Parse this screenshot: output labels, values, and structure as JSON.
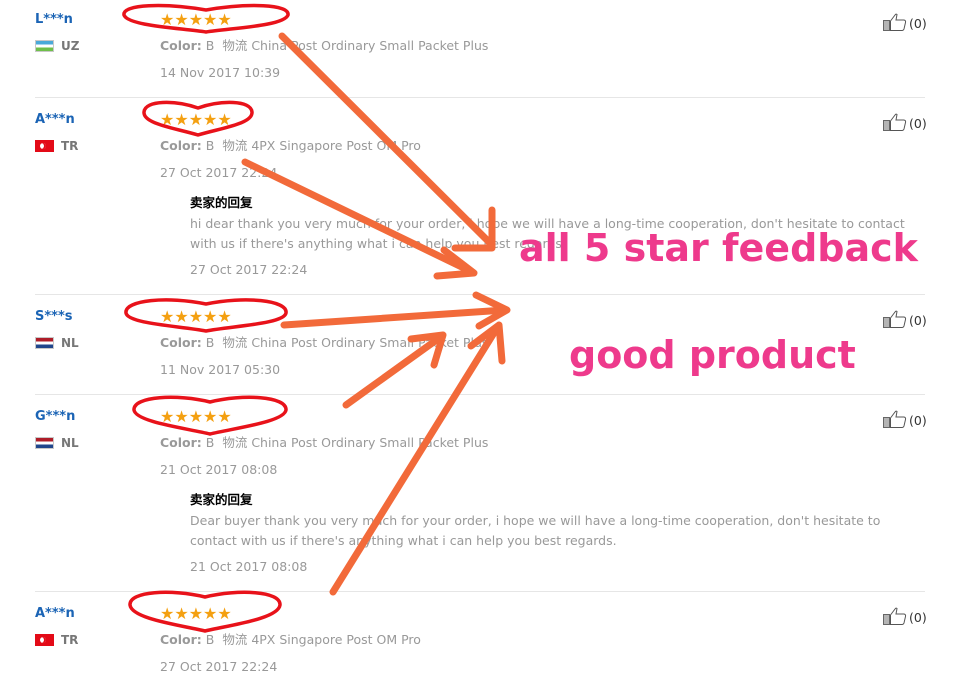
{
  "reviews": [
    {
      "buyer": "L***n",
      "country": "UZ",
      "rating": 5,
      "stars": "★★★★★",
      "color_label": "Color:",
      "color_value": "B",
      "shipping_label": "物流",
      "shipping_value": "China Post Ordinary Small Packet Plus",
      "date": "14 Nov 2017 10:39",
      "helpful": "(0)"
    },
    {
      "buyer": "A***n",
      "country": "TR",
      "rating": 5,
      "stars": "★★★★★",
      "color_label": "Color:",
      "color_value": "B",
      "shipping_label": "物流",
      "shipping_value": "4PX Singapore Post OM Pro",
      "date": "27 Oct 2017 22:24",
      "helpful": "(0)",
      "reply_title": "卖家的回复",
      "reply_text": "hi dear thank you very much for your order, i hope we will have a long-time cooperation, don't hesitate to contact with us if there's anything what i can help you best regards.",
      "reply_date": "27 Oct 2017 22:24"
    },
    {
      "buyer": "S***s",
      "country": "NL",
      "rating": 5,
      "stars": "★★★★★",
      "color_label": "Color:",
      "color_value": "B",
      "shipping_label": "物流",
      "shipping_value": "China Post Ordinary Small Packet Plus",
      "date": "11 Nov 2017 05:30",
      "helpful": "(0)"
    },
    {
      "buyer": "G***n",
      "country": "NL",
      "rating": 5,
      "stars": "★★★★★",
      "color_label": "Color:",
      "color_value": "B",
      "shipping_label": "物流",
      "shipping_value": "China Post Ordinary Small Packet Plus",
      "date": "21 Oct 2017 08:08",
      "helpful": "(0)",
      "reply_title": "卖家的回复",
      "reply_text": "Dear buyer thank you very much for your order, i hope we will have a long-time cooperation, don't hesitate to contact with us if there's anything what i can help you best regards.",
      "reply_date": "21 Oct 2017 08:08"
    },
    {
      "buyer": "A***n",
      "country": "TR",
      "rating": 5,
      "stars": "★★★★★",
      "color_label": "Color:",
      "color_value": "B",
      "shipping_label": "物流",
      "shipping_value": "4PX Singapore Post OM Pro",
      "date": "27 Oct 2017 22:24",
      "helpful": "(0)"
    }
  ],
  "annotations": {
    "headline": "all 5 star feedback",
    "subline": "good product",
    "text_color": "#ee3a8c",
    "arrow_color": "#f26a3a",
    "heart_color": "#e8121a"
  },
  "colors": {
    "buyer_link": "#1b64b5",
    "star": "#f4a011",
    "muted_text": "#999999"
  },
  "icons": {
    "helpful": "thumbs-up-icon",
    "flags": [
      "flag-uz-icon",
      "flag-tr-icon",
      "flag-nl-icon"
    ]
  }
}
